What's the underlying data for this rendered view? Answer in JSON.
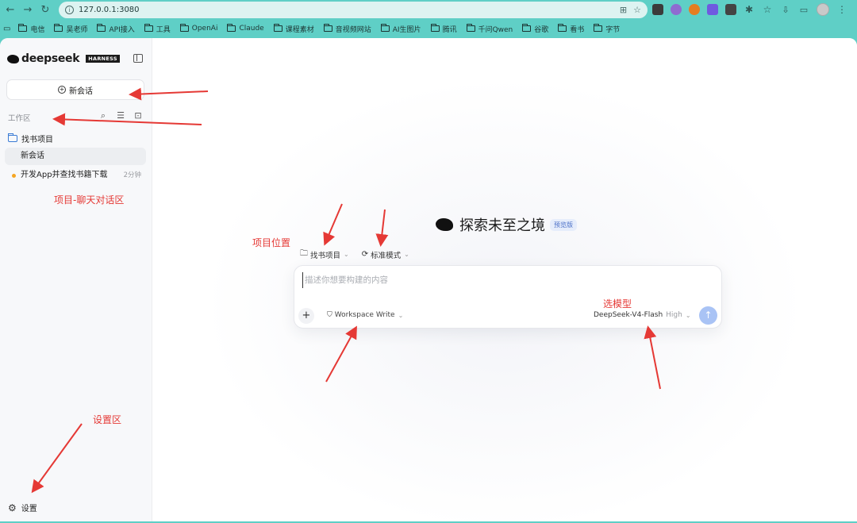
{
  "browser": {
    "url": "127.0.0.1:3080",
    "bookmarks": [
      "电信",
      "吴老师",
      "API接入",
      "工具",
      "OpenAi",
      "Claude",
      "课程素材",
      "音视频网站",
      "AI生图片",
      "腾讯",
      "千问Qwen",
      "谷歌",
      "看书",
      "字节"
    ]
  },
  "sidebar": {
    "logo_text": "deepseek",
    "logo_badge": "HARNESS",
    "new_chat_label": "新会话",
    "workspace_label": "工作区",
    "project_name": "找书项目",
    "active_chat": "新会话",
    "chats": [
      {
        "title": "开发App并查找书籍下载",
        "time": "2分钟"
      }
    ],
    "settings_label": "设置"
  },
  "main": {
    "hero_title": "探索未至之境",
    "preview_badge": "预览版",
    "project_selector": "找书项目",
    "mode_selector": "标准模式",
    "input_placeholder": "描述你想要构建的内容",
    "workspace_mode": "Workspace Write",
    "model": "DeepSeek-V4-Flash",
    "model_level": "High"
  },
  "annotations": {
    "chat_area": "项目-聊天对话区",
    "project_location": "项目位置",
    "model_select": "选模型",
    "settings_area": "设置区"
  },
  "colors": {
    "browser_chrome": "#5fcfc6",
    "annotation": "#e53935",
    "send_button": "#a9c3f5",
    "folder_accent": "#3a7bd5",
    "status_dot": "#f5a623"
  }
}
